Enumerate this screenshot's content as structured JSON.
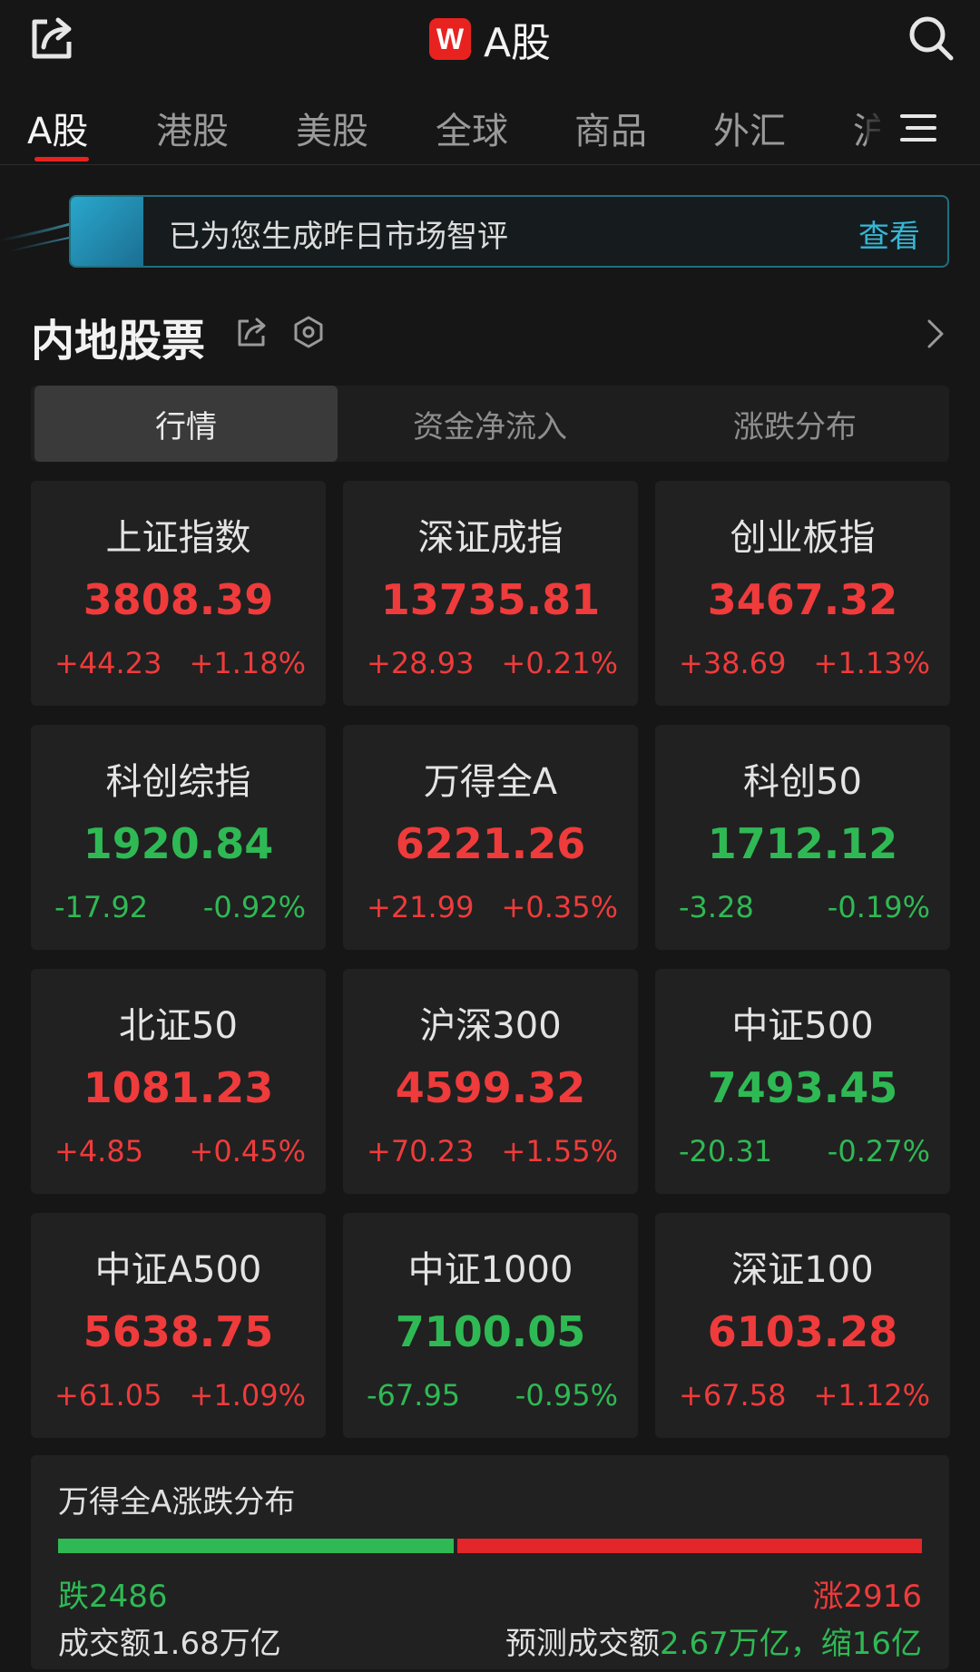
{
  "header": {
    "logo_letter": "W",
    "title": "A股"
  },
  "tabs": [
    {
      "label": "A股",
      "active": true
    },
    {
      "label": "港股",
      "active": false
    },
    {
      "label": "美股",
      "active": false
    },
    {
      "label": "全球",
      "active": false
    },
    {
      "label": "商品",
      "active": false
    },
    {
      "label": "外汇",
      "active": false
    },
    {
      "label": "沪",
      "active": false
    }
  ],
  "banner": {
    "text": "已为您生成昨日市场智评",
    "link": "查看"
  },
  "section": {
    "title": "内地股票"
  },
  "subtabs": [
    {
      "label": "行情",
      "active": true
    },
    {
      "label": "资金净流入",
      "active": false
    },
    {
      "label": "涨跌分布",
      "active": false
    }
  ],
  "indices": [
    {
      "name": "上证指数",
      "value": "3808.39",
      "change": "+44.23",
      "pct": "+1.18%",
      "dir": "up"
    },
    {
      "name": "深证成指",
      "value": "13735.81",
      "change": "+28.93",
      "pct": "+0.21%",
      "dir": "up"
    },
    {
      "name": "创业板指",
      "value": "3467.32",
      "change": "+38.69",
      "pct": "+1.13%",
      "dir": "up"
    },
    {
      "name": "科创综指",
      "value": "1920.84",
      "change": "-17.92",
      "pct": "-0.92%",
      "dir": "down"
    },
    {
      "name": "万得全A",
      "value": "6221.26",
      "change": "+21.99",
      "pct": "+0.35%",
      "dir": "up"
    },
    {
      "name": "科创50",
      "value": "1712.12",
      "change": "-3.28",
      "pct": "-0.19%",
      "dir": "down"
    },
    {
      "name": "北证50",
      "value": "1081.23",
      "change": "+4.85",
      "pct": "+0.45%",
      "dir": "up"
    },
    {
      "name": "沪深300",
      "value": "4599.32",
      "change": "+70.23",
      "pct": "+1.55%",
      "dir": "up"
    },
    {
      "name": "中证500",
      "value": "7493.45",
      "change": "-20.31",
      "pct": "-0.27%",
      "dir": "down"
    },
    {
      "name": "中证A500",
      "value": "5638.75",
      "change": "+61.05",
      "pct": "+1.09%",
      "dir": "up"
    },
    {
      "name": "中证1000",
      "value": "7100.05",
      "change": "-67.95",
      "pct": "-0.95%",
      "dir": "down"
    },
    {
      "name": "深证100",
      "value": "6103.28",
      "change": "+67.58",
      "pct": "+1.12%",
      "dir": "up"
    }
  ],
  "distribution": {
    "title": "万得全A涨跌分布",
    "fall_label": "跌2486",
    "rise_label": "涨2916",
    "fall_count": 2486,
    "rise_count": 2916,
    "turnover": "成交额1.68万亿",
    "forecast_prefix": "预测成交额",
    "forecast_value": "2.67万亿，缩16亿"
  },
  "colors": {
    "up": "#ef3b3b",
    "down": "#2fb954",
    "accent": "#e8231f",
    "link": "#37b6d5"
  },
  "icons": [
    "share-icon",
    "search-icon",
    "menu-icon",
    "gear-icon",
    "chevron-right-icon"
  ]
}
